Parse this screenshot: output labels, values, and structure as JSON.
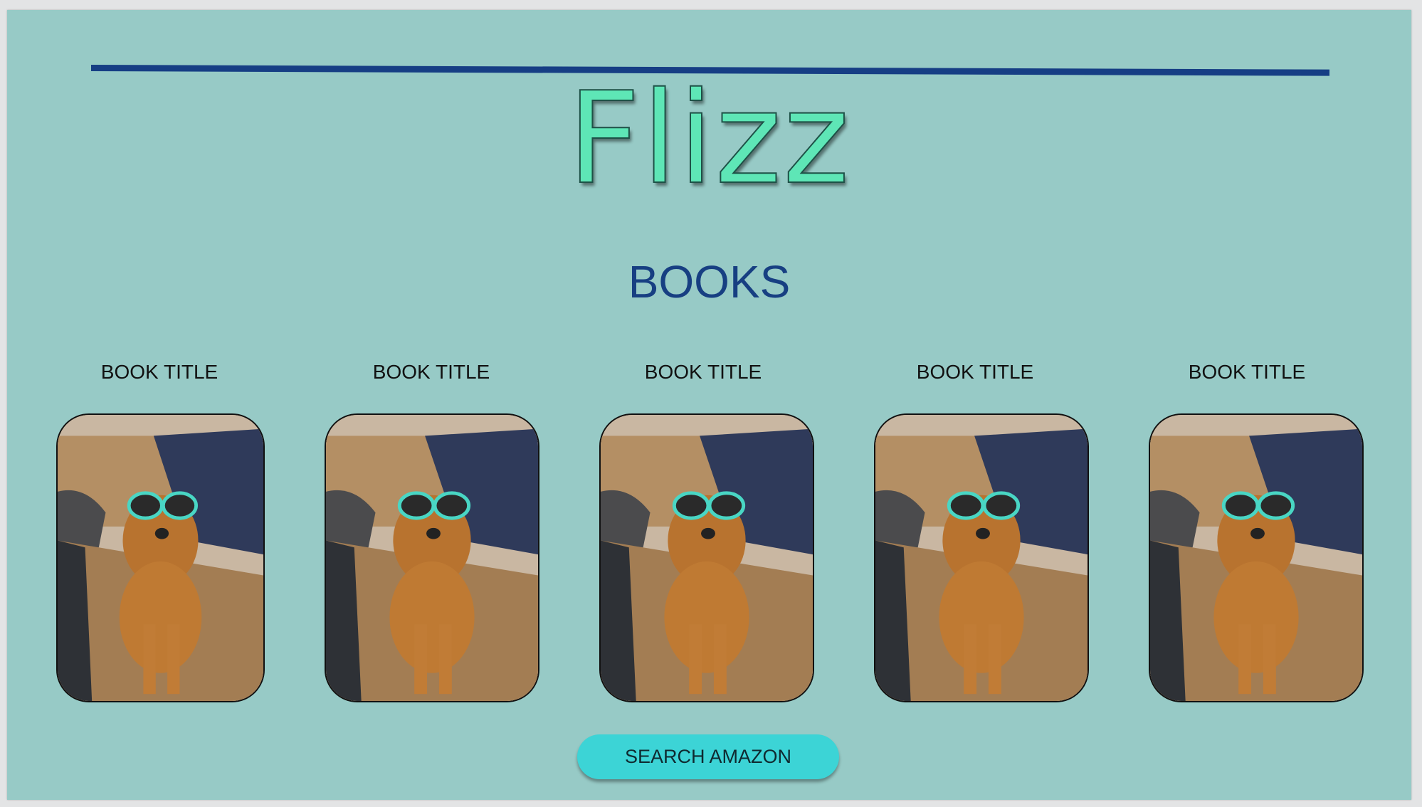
{
  "header": {
    "logo_text": "Flizz",
    "section_title": "BOOKS"
  },
  "books": [
    {
      "title": "BOOK TITLE"
    },
    {
      "title": "BOOK TITLE"
    },
    {
      "title": "BOOK TITLE"
    },
    {
      "title": "BOOK TITLE"
    },
    {
      "title": "BOOK TITLE"
    }
  ],
  "actions": {
    "search_label": "SEARCH AMAZON"
  },
  "colors": {
    "background": "#97cac6",
    "rule": "#163e84",
    "logo": "#5ee6b6",
    "title": "#173f82",
    "button": "#3cd4d6"
  }
}
